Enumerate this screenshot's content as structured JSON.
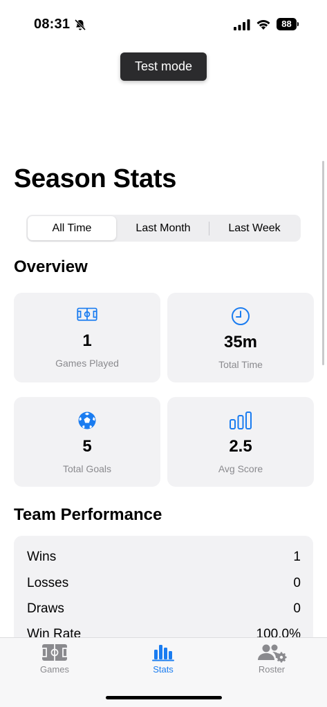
{
  "status": {
    "time": "08:31",
    "battery": "88"
  },
  "test_mode": "Test mode",
  "page_title": "Season Stats",
  "filter": {
    "options": [
      "All Time",
      "Last Month",
      "Last Week"
    ],
    "selected": "All Time"
  },
  "overview": {
    "title": "Overview",
    "cards": [
      {
        "icon": "field-icon",
        "value": "1",
        "label": "Games Played"
      },
      {
        "icon": "clock-icon",
        "value": "35m",
        "label": "Total Time"
      },
      {
        "icon": "soccer-ball-icon",
        "value": "5",
        "label": "Total Goals"
      },
      {
        "icon": "bar-chart-icon",
        "value": "2.5",
        "label": "Avg Score"
      }
    ]
  },
  "performance": {
    "title": "Team Performance",
    "rows": [
      {
        "label": "Wins",
        "value": "1"
      },
      {
        "label": "Losses",
        "value": "0"
      },
      {
        "label": "Draws",
        "value": "0"
      },
      {
        "label": "Win Rate",
        "value": "100.0%"
      }
    ]
  },
  "tabs": [
    {
      "icon": "field-icon",
      "label": "Games"
    },
    {
      "icon": "stats-icon",
      "label": "Stats"
    },
    {
      "icon": "roster-icon",
      "label": "Roster"
    }
  ],
  "colors": {
    "accent": "#1a7cf0",
    "card_bg": "#f2f2f4",
    "inactive": "#8a8a8e"
  }
}
